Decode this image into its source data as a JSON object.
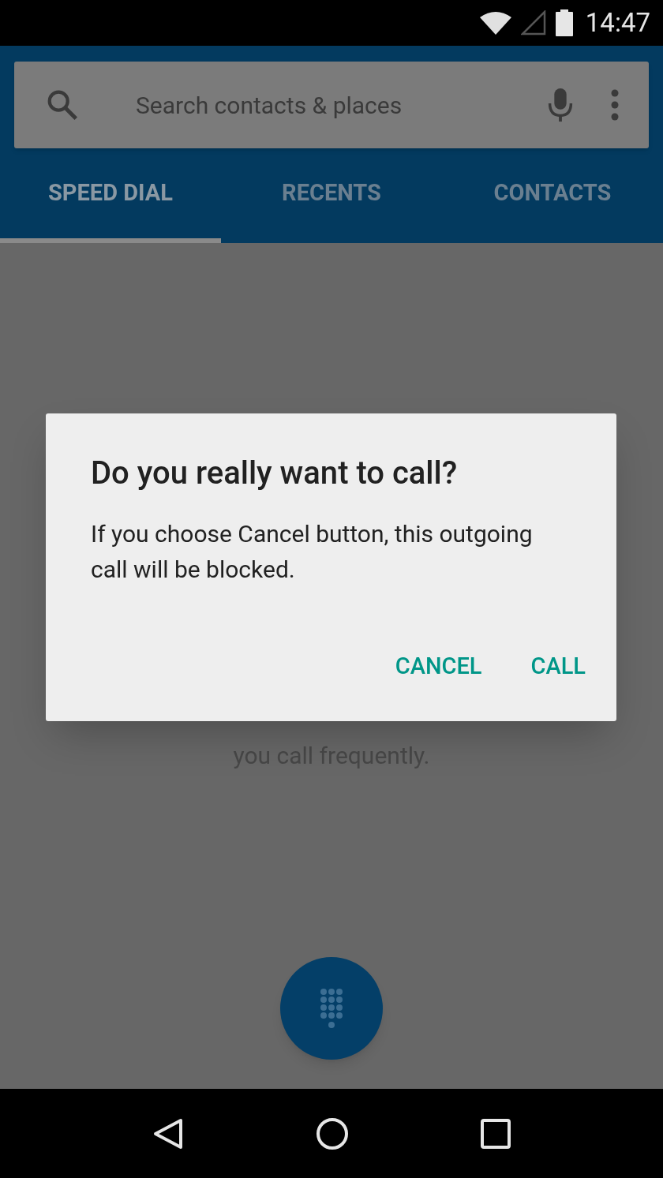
{
  "status_bar": {
    "time": "14:47"
  },
  "search": {
    "placeholder": "Search contacts & places"
  },
  "tabs": [
    {
      "label": "SPEED DIAL",
      "selected": true
    },
    {
      "label": "RECENTS",
      "selected": false
    },
    {
      "label": "CONTACTS",
      "selected": false
    }
  ],
  "empty_state": {
    "lines": [
      "you call frequently."
    ]
  },
  "dialog": {
    "title": "Do you really want to call?",
    "message": "If you choose Cancel button, this outgoing call will be blocked.",
    "buttons": [
      "CANCEL",
      "CALL"
    ]
  }
}
